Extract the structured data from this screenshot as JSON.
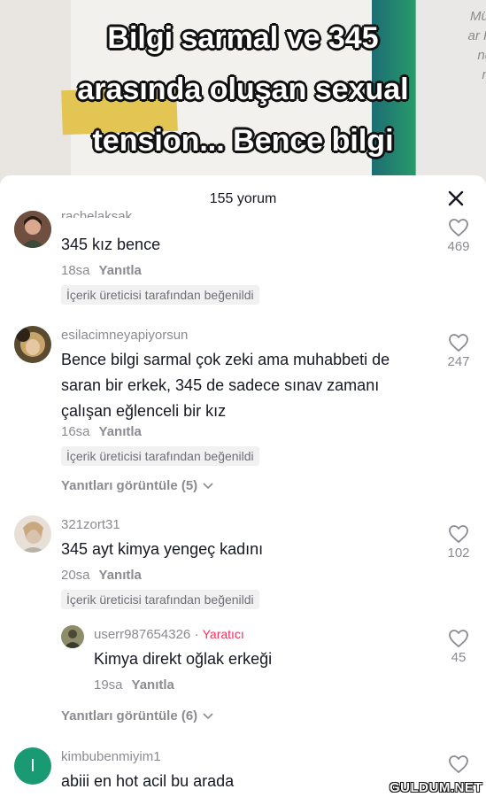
{
  "video": {
    "overlay_lines": [
      "Bilgi sarmal ve 345",
      "arasında oluşan sexual",
      "tension... Bence bilgi"
    ],
    "cover_text": [
      "Müf",
      "ar K",
      "nu",
      "ni"
    ]
  },
  "sheet": {
    "comment_count": "155 yorum"
  },
  "comments": [
    {
      "username": "rachelaksak",
      "text": "345 kız bence",
      "time": "18sa",
      "reply_label": "Yanıtla",
      "liked_badge": "İçerik üreticisi tarafından beğenildi",
      "likes": "469"
    },
    {
      "username": "esilacimneyapiyorsun",
      "text_lines": [
        "Bence bilgi sarmal çok zeki ama muhabbeti de",
        "saran bir erkek, 345 de sadece sınav zamanı",
        "çalışan eğlenceli bir kız"
      ],
      "time": "16sa",
      "reply_label": "Yanıtla",
      "liked_badge": "İçerik üreticisi tarafından beğenildi",
      "likes": "247",
      "view_replies": "Yanıtları görüntüle (5)"
    },
    {
      "username": "321zort31",
      "text": "345 ayt kimya yengeç kadını",
      "time": "20sa",
      "reply_label": "Yanıtla",
      "liked_badge": "İçerik üreticisi tarafından beğenildi",
      "likes": "102",
      "reply": {
        "username": "userr987654326",
        "separator": "·",
        "creator_label": "Yaratıcı",
        "text": "Kimya direkt oğlak erkeği",
        "time": "19sa",
        "reply_label": "Yanıtla",
        "likes": "45"
      },
      "view_replies": "Yanıtları görüntüle (6)"
    },
    {
      "username": "kimbubenmiyim1",
      "avatar_letter": "I",
      "text": "abiii en hot acil bu arada"
    }
  ],
  "watermark": "GULDUM.NET",
  "colors": {
    "accent_red": "#fe2c55",
    "avatar_green": "#1a9a73"
  }
}
